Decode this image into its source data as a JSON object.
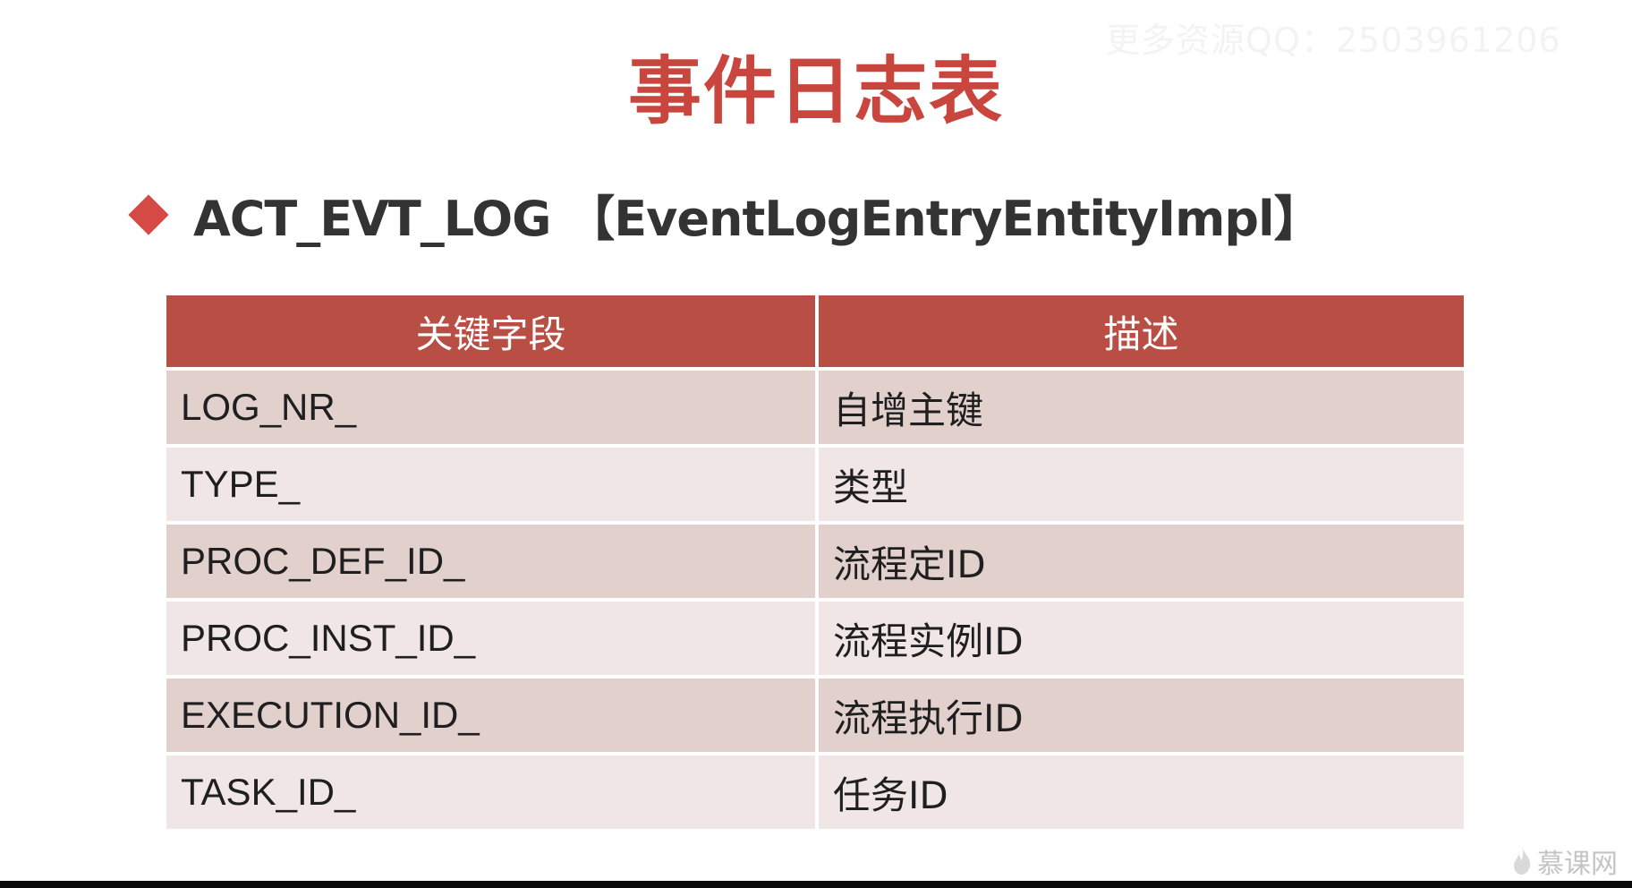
{
  "watermark": "更多资源QQ：2503961206",
  "title": "事件日志表",
  "subtitle": "ACT_EVT_LOG 【EventLogEntryEntityImpl】",
  "table": {
    "headers": [
      "关键字段",
      "描述"
    ],
    "rows": [
      [
        "LOG_NR_",
        "自增主键"
      ],
      [
        "TYPE_",
        "类型"
      ],
      [
        "PROC_DEF_ID_",
        "流程定ID"
      ],
      [
        "PROC_INST_ID_",
        "流程实例ID"
      ],
      [
        "EXECUTION_ID_",
        "流程执行ID"
      ],
      [
        "TASK_ID_",
        "任务ID"
      ]
    ]
  },
  "logo": {
    "text": "慕课网",
    "icon": "flame-icon"
  },
  "colors": {
    "title": "#c9463f",
    "bullet": "#d64a46",
    "header_bg": "#b84e44",
    "row_odd": "#e2d0cd",
    "row_even": "#efe6e5"
  }
}
